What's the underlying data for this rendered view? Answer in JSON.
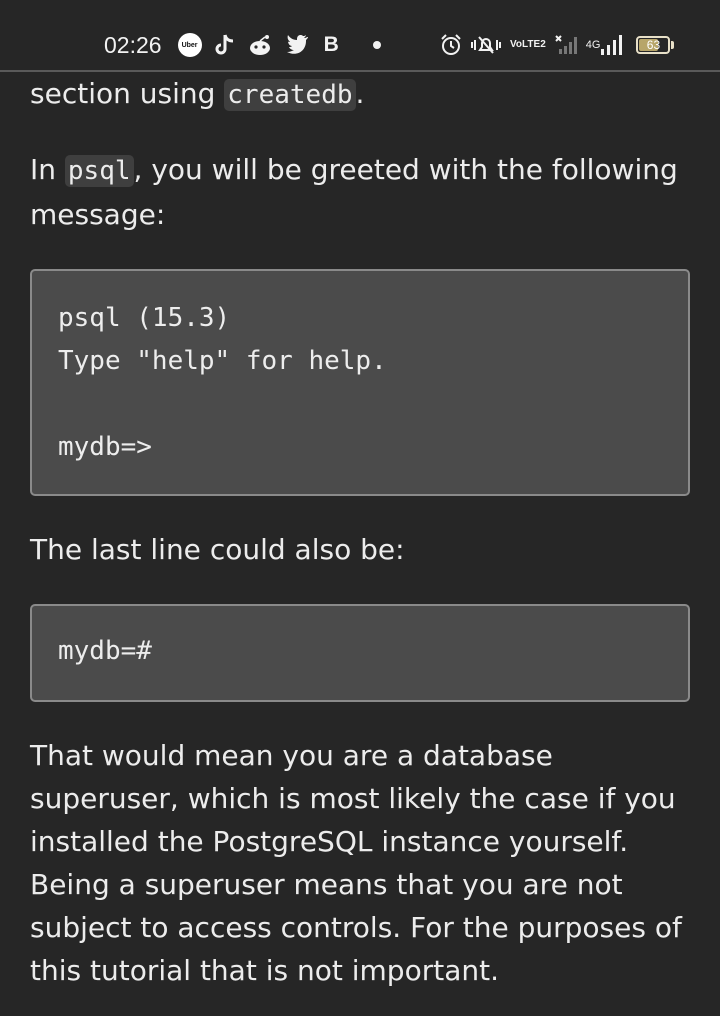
{
  "status_bar": {
    "time": "02:26",
    "uber_label": "Uber",
    "b_label": "B",
    "volte_top": "Vo",
    "volte_bottom": "LTE2",
    "network_label": "4G",
    "battery_level": "63",
    "icons": [
      "uber-icon",
      "tiktok-icon",
      "reddit-icon",
      "twitter-icon",
      "b-icon",
      "dot-icon",
      "alarm-icon",
      "mute-icon",
      "volte-icon",
      "no-signal-icon",
      "signal-4g-icon",
      "battery-icon"
    ]
  },
  "article": {
    "para1_text": "section using ",
    "para1_code": "createdb",
    "para1_end": ".",
    "para2_start": "In ",
    "para2_code": "psql",
    "para2_end": ", you will be greeted with the following message:",
    "code_block_1": "psql (15.3)\nType \"help\" for help.\n\nmydb=>",
    "para3": "The last line could also be:",
    "code_block_2": "mydb=#",
    "para4": "That would mean you are a database superuser, which is most likely the case if you installed the PostgreSQL instance yourself. Being a superuser means that you are not subject to access controls. For the purposes of this tutorial that is not important."
  },
  "colors": {
    "background": "#262626",
    "text": "#ececec",
    "code_block_bg": "#4b4b4b",
    "inline_code_bg": "#3f3f3f"
  }
}
